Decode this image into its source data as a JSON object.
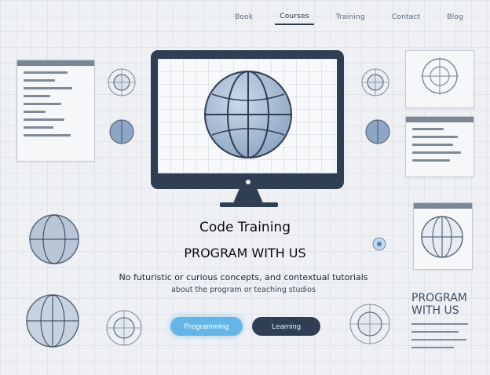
{
  "nav": {
    "items": [
      "Book",
      "Courses",
      "Training",
      "Contact",
      "Blog"
    ],
    "active_index": 1
  },
  "hero": {
    "title": "Code Training",
    "subtitle": "PROGRAM WITH US",
    "tagline_line1": "No futuristic or curious concepts, and contextual tutorials",
    "tagline_line2": "about the program or teaching studios"
  },
  "buttons": {
    "primary_label": "Programming",
    "secondary_label": "Learning"
  },
  "side_card": {
    "title_line1": "PROGRAM",
    "title_line2": "WITH US"
  },
  "colors": {
    "dark": "#2f3e52",
    "accent": "#65b6e6",
    "background": "#eef0f4"
  }
}
